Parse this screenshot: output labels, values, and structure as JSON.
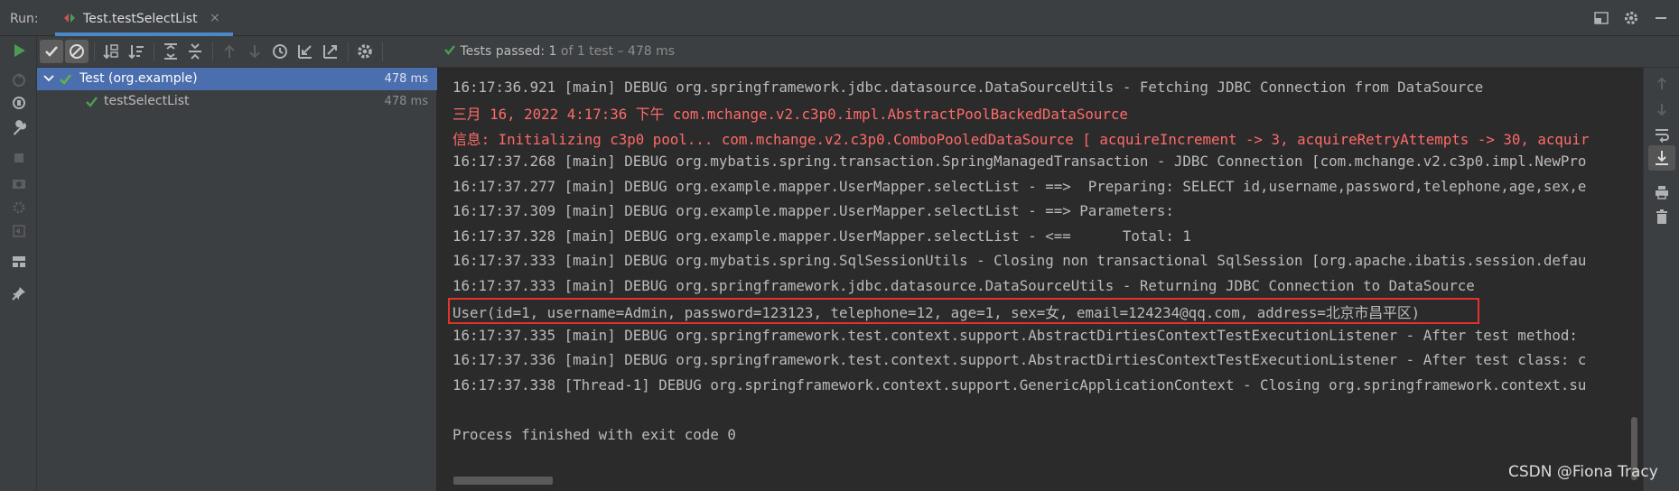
{
  "header": {
    "run_label": "Run:",
    "tab_title": "Test.testSelectList",
    "tab_close": "×"
  },
  "status": {
    "passed_label": "Tests passed:",
    "passed_count": "1",
    "detail": "of 1 test – 478 ms"
  },
  "tree": {
    "items": [
      {
        "name": "Test (org.example)",
        "duration": "478 ms",
        "expanded": true,
        "selected": true,
        "status": "passed"
      },
      {
        "name": "testSelectList",
        "duration": "478 ms",
        "selected": false,
        "status": "passed"
      }
    ]
  },
  "console": {
    "lines": [
      {
        "text": "16:17:36.921 [main] DEBUG org.springframework.jdbc.datasource.DataSourceUtils - Fetching JDBC Connection from DataSource",
        "color": "#bbbbbb"
      },
      {
        "text": "三月 16, 2022 4:17:36 下午 com.mchange.v2.c3p0.impl.AbstractPoolBackedDataSource",
        "color": "#ff6b68"
      },
      {
        "text": "信息: Initializing c3p0 pool... com.mchange.v2.c3p0.ComboPooledDataSource [ acquireIncrement -> 3, acquireRetryAttempts -> 30, acquir",
        "color": "#ff6b68"
      },
      {
        "text": "16:17:37.268 [main] DEBUG org.mybatis.spring.transaction.SpringManagedTransaction - JDBC Connection [com.mchange.v2.c3p0.impl.NewPro",
        "color": "#bbbbbb"
      },
      {
        "text": "16:17:37.277 [main] DEBUG org.example.mapper.UserMapper.selectList - ==>  Preparing: SELECT id,username,password,telephone,age,sex,e",
        "color": "#bbbbbb"
      },
      {
        "text": "16:17:37.309 [main] DEBUG org.example.mapper.UserMapper.selectList - ==> Parameters: ",
        "color": "#bbbbbb"
      },
      {
        "text": "16:17:37.328 [main] DEBUG org.example.mapper.UserMapper.selectList - <==      Total: 1",
        "color": "#bbbbbb"
      },
      {
        "text": "16:17:37.333 [main] DEBUG org.mybatis.spring.SqlSessionUtils - Closing non transactional SqlSession [org.apache.ibatis.session.defau",
        "color": "#bbbbbb"
      },
      {
        "text": "16:17:37.333 [main] DEBUG org.springframework.jdbc.datasource.DataSourceUtils - Returning JDBC Connection to DataSource",
        "color": "#bbbbbb"
      },
      {
        "text": "User(id=1, username=Admin, password=123123, telephone=12, age=1, sex=女, email=124234@qq.com, address=北京市昌平区)",
        "color": "#bbbbbb"
      },
      {
        "text": "16:17:37.335 [main] DEBUG org.springframework.test.context.support.AbstractDirtiesContextTestExecutionListener - After test method:",
        "color": "#bbbbbb"
      },
      {
        "text": "16:17:37.336 [main] DEBUG org.springframework.test.context.support.AbstractDirtiesContextTestExecutionListener - After test class: c",
        "color": "#bbbbbb"
      },
      {
        "text": "16:17:37.338 [Thread-1] DEBUG org.springframework.context.support.GenericApplicationContext - Closing org.springframework.context.su",
        "color": "#bbbbbb"
      },
      {
        "text": "",
        "color": "#bbbbbb"
      },
      {
        "text": "Process finished with exit code 0",
        "color": "#bbbbbb"
      }
    ]
  },
  "watermark": "CSDN @Fiona Tracy",
  "colors": {
    "accent": "#4a88c7",
    "success": "#499c54",
    "error_text": "#ff6b68",
    "highlight_border": "#e5322d",
    "selection": "#4b6eaf"
  }
}
